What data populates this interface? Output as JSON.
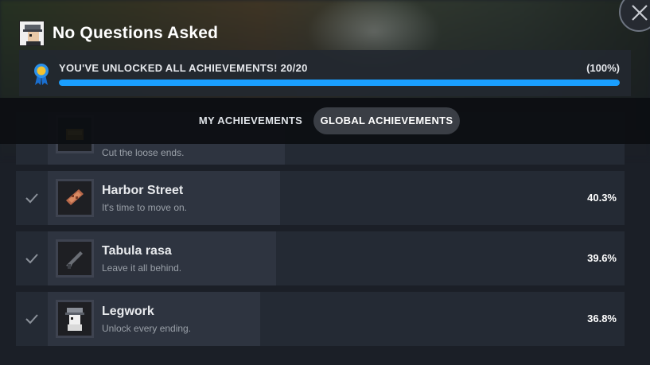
{
  "game": {
    "title": "No Questions Asked",
    "icon": "pixel-character-icon"
  },
  "close": {
    "icon": "close-icon"
  },
  "progress": {
    "label": "YOU'VE UNLOCKED ALL ACHIEVEMENTS! 20/20",
    "percent_text": "(100%)",
    "fraction": 1.0,
    "icon": "medal-icon"
  },
  "tabs": [
    {
      "label": "MY ACHIEVEMENTS",
      "active": false
    },
    {
      "label": "GLOBAL ACHIEVEMENTS",
      "active": true
    }
  ],
  "achievements": [
    {
      "name": "",
      "description": "Cut the loose ends.",
      "percent": "",
      "icon": "gold-item-icon",
      "unlocked": true
    },
    {
      "name": "Harbor Street",
      "description": "It's time to move on.",
      "percent": "40.3%",
      "icon": "map-scroll-icon",
      "unlocked": true
    },
    {
      "name": "Tabula rasa",
      "description": "Leave it all behind.",
      "percent": "39.6%",
      "icon": "gun-icon",
      "unlocked": true
    },
    {
      "name": "Legwork",
      "description": "Unlock every ending.",
      "percent": "36.8%",
      "icon": "pixel-character-icon",
      "unlocked": true
    }
  ],
  "colors": {
    "accent": "#1a9fff",
    "background": "#1b1f27",
    "row": "#242a34"
  }
}
